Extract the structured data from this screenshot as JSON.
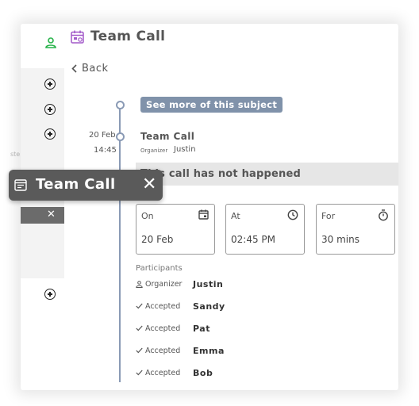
{
  "header": {
    "title": "Team Call"
  },
  "nav": {
    "back_label": "Back"
  },
  "timeline": {
    "subject_button": "See more of this subject",
    "event": {
      "date": "20 Feb",
      "time": "14:45",
      "title": "Team Call",
      "organizer_label": "Organizer",
      "organizer": "Justin"
    }
  },
  "status_banner": {
    "text": "This call has not happened"
  },
  "details": {
    "on": {
      "label": "On",
      "value": "20 Feb",
      "icon": "calendar-icon"
    },
    "at": {
      "label": "At",
      "value": "02:45 PM",
      "icon": "clock-icon"
    },
    "for": {
      "label": "For",
      "value": "30 mins",
      "icon": "timer-icon"
    }
  },
  "participants": {
    "header": "Participants",
    "rows": [
      {
        "role": "Organizer",
        "name": "Justin"
      },
      {
        "role": "Accepted",
        "name": "Sandy"
      },
      {
        "role": "Accepted",
        "name": "Pat"
      },
      {
        "role": "Accepted",
        "name": "Emma"
      },
      {
        "role": "Accepted",
        "name": "Bob"
      }
    ]
  },
  "overlay": {
    "title": "Team Call"
  },
  "sidebar": {
    "ghost_text": "ste"
  },
  "colors": {
    "accent": "#8092aa",
    "person_icon": "#27b34a",
    "title_icon": "#a259c9"
  }
}
